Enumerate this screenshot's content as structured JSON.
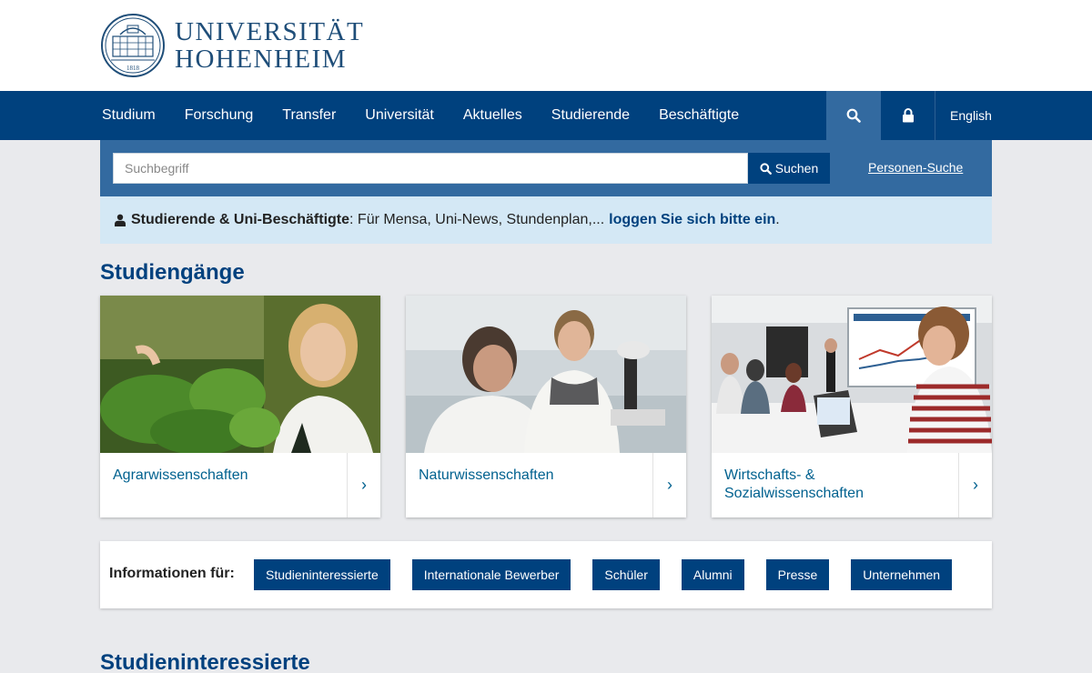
{
  "brand": {
    "line1": "UNIVERSITÄT",
    "line2": "HOHENHEIM",
    "seal_year": "1818"
  },
  "nav": {
    "items": [
      "Studium",
      "Forschung",
      "Transfer",
      "Universität",
      "Aktuelles",
      "Studierende",
      "Beschäftigte"
    ],
    "language": "English",
    "icons": {
      "search": "search-icon",
      "lock": "lock-icon"
    }
  },
  "search": {
    "placeholder": "Suchbegriff",
    "value": "",
    "button_label": "Suchen",
    "people_link": "Personen-Suche"
  },
  "login_notice": {
    "strong": "Studierende & Uni-Beschäftigte",
    "text": ": Für Mensa, Uni-News, Stundenplan,... ",
    "link": "loggen Sie sich bitte ein",
    "end": "."
  },
  "sections": {
    "programs_title": "Studiengänge",
    "prospective_title": "Studieninteressierte"
  },
  "cards": [
    {
      "label": "Agrarwissenschaften",
      "arrow": "›"
    },
    {
      "label": "Naturwissenschaften",
      "arrow": "›"
    },
    {
      "label": "Wirtschafts- & Sozialwissenschaften",
      "arrow": "›"
    }
  ],
  "info_for": {
    "label": "Informationen für:",
    "buttons": [
      "Studieninteressierte",
      "Internationale Bewerber",
      "Schüler",
      "Alumni",
      "Presse",
      "Unternehmen"
    ]
  },
  "colors": {
    "nav": "#00417e",
    "search_band": "#336aa0",
    "notice": "#d4e8f5",
    "link": "#00618f",
    "background": "#e9eaed"
  }
}
